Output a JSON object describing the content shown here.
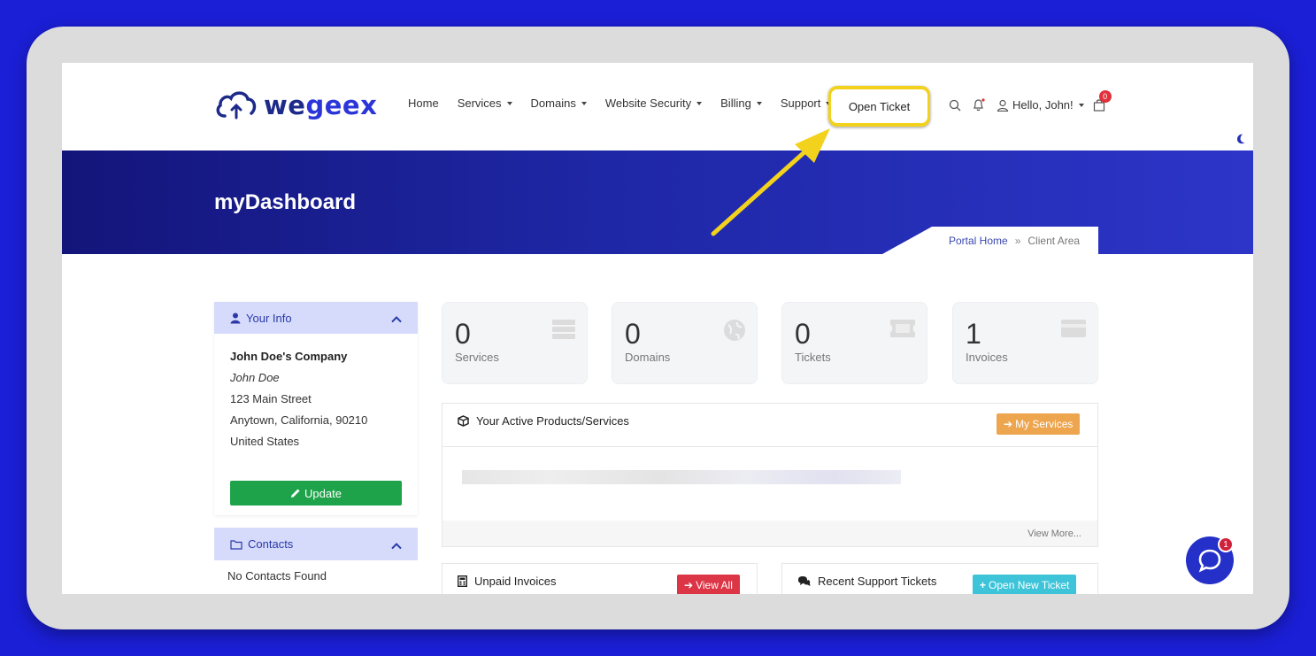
{
  "header": {
    "nav": [
      {
        "label": "Home",
        "dropdown": false
      },
      {
        "label": "Services",
        "dropdown": true
      },
      {
        "label": "Domains",
        "dropdown": true
      },
      {
        "label": "Website Security",
        "dropdown": true
      },
      {
        "label": "Billing",
        "dropdown": true
      },
      {
        "label": "Support",
        "dropdown": true
      }
    ],
    "open_ticket_label": "Open Ticket",
    "user_greeting": "Hello, John!",
    "cart_count": "0",
    "icons": [
      "search-icon",
      "bell-icon",
      "user-icon",
      "cart-icon",
      "moon-icon"
    ]
  },
  "logo": {
    "text_part1": "we",
    "text_part2": "geex"
  },
  "hero": {
    "title": "myDashboard",
    "breadcrumb": {
      "home": "Portal Home",
      "current": "Client Area"
    }
  },
  "sidebar": {
    "your_info": {
      "title": "Your Info",
      "company": "John Doe's Company",
      "name": "John Doe",
      "address1": "123 Main Street",
      "address2": "Anytown, California, 90210",
      "country": "United States",
      "update_label": "Update"
    },
    "contacts": {
      "title": "Contacts",
      "empty_text": "No Contacts Found"
    }
  },
  "stats": [
    {
      "count": "0",
      "label": "Services",
      "icon": "server-icon"
    },
    {
      "count": "0",
      "label": "Domains",
      "icon": "globe-icon"
    },
    {
      "count": "0",
      "label": "Tickets",
      "icon": "ticket-icon"
    },
    {
      "count": "1",
      "label": "Invoices",
      "icon": "credit-card-icon"
    }
  ],
  "active_products": {
    "title": "Your Active Products/Services",
    "button": "My Services",
    "footer_link": "View More..."
  },
  "unpaid_invoices": {
    "title": "Unpaid Invoices",
    "button": "View All"
  },
  "support_tickets": {
    "title": "Recent Support Tickets",
    "button": "Open New Ticket"
  },
  "chat": {
    "badge": "1"
  },
  "colors": {
    "brand_dark": "#1e2a8a",
    "brand_blue": "#2b35d8",
    "highlight_yellow": "#f2d21c",
    "update_green": "#1ea34a",
    "my_services_orange": "#eda54e",
    "view_all_red": "#dc3545",
    "open_new_ticket_teal": "#3ec4d9",
    "background_blue": "#1b1fd6"
  }
}
